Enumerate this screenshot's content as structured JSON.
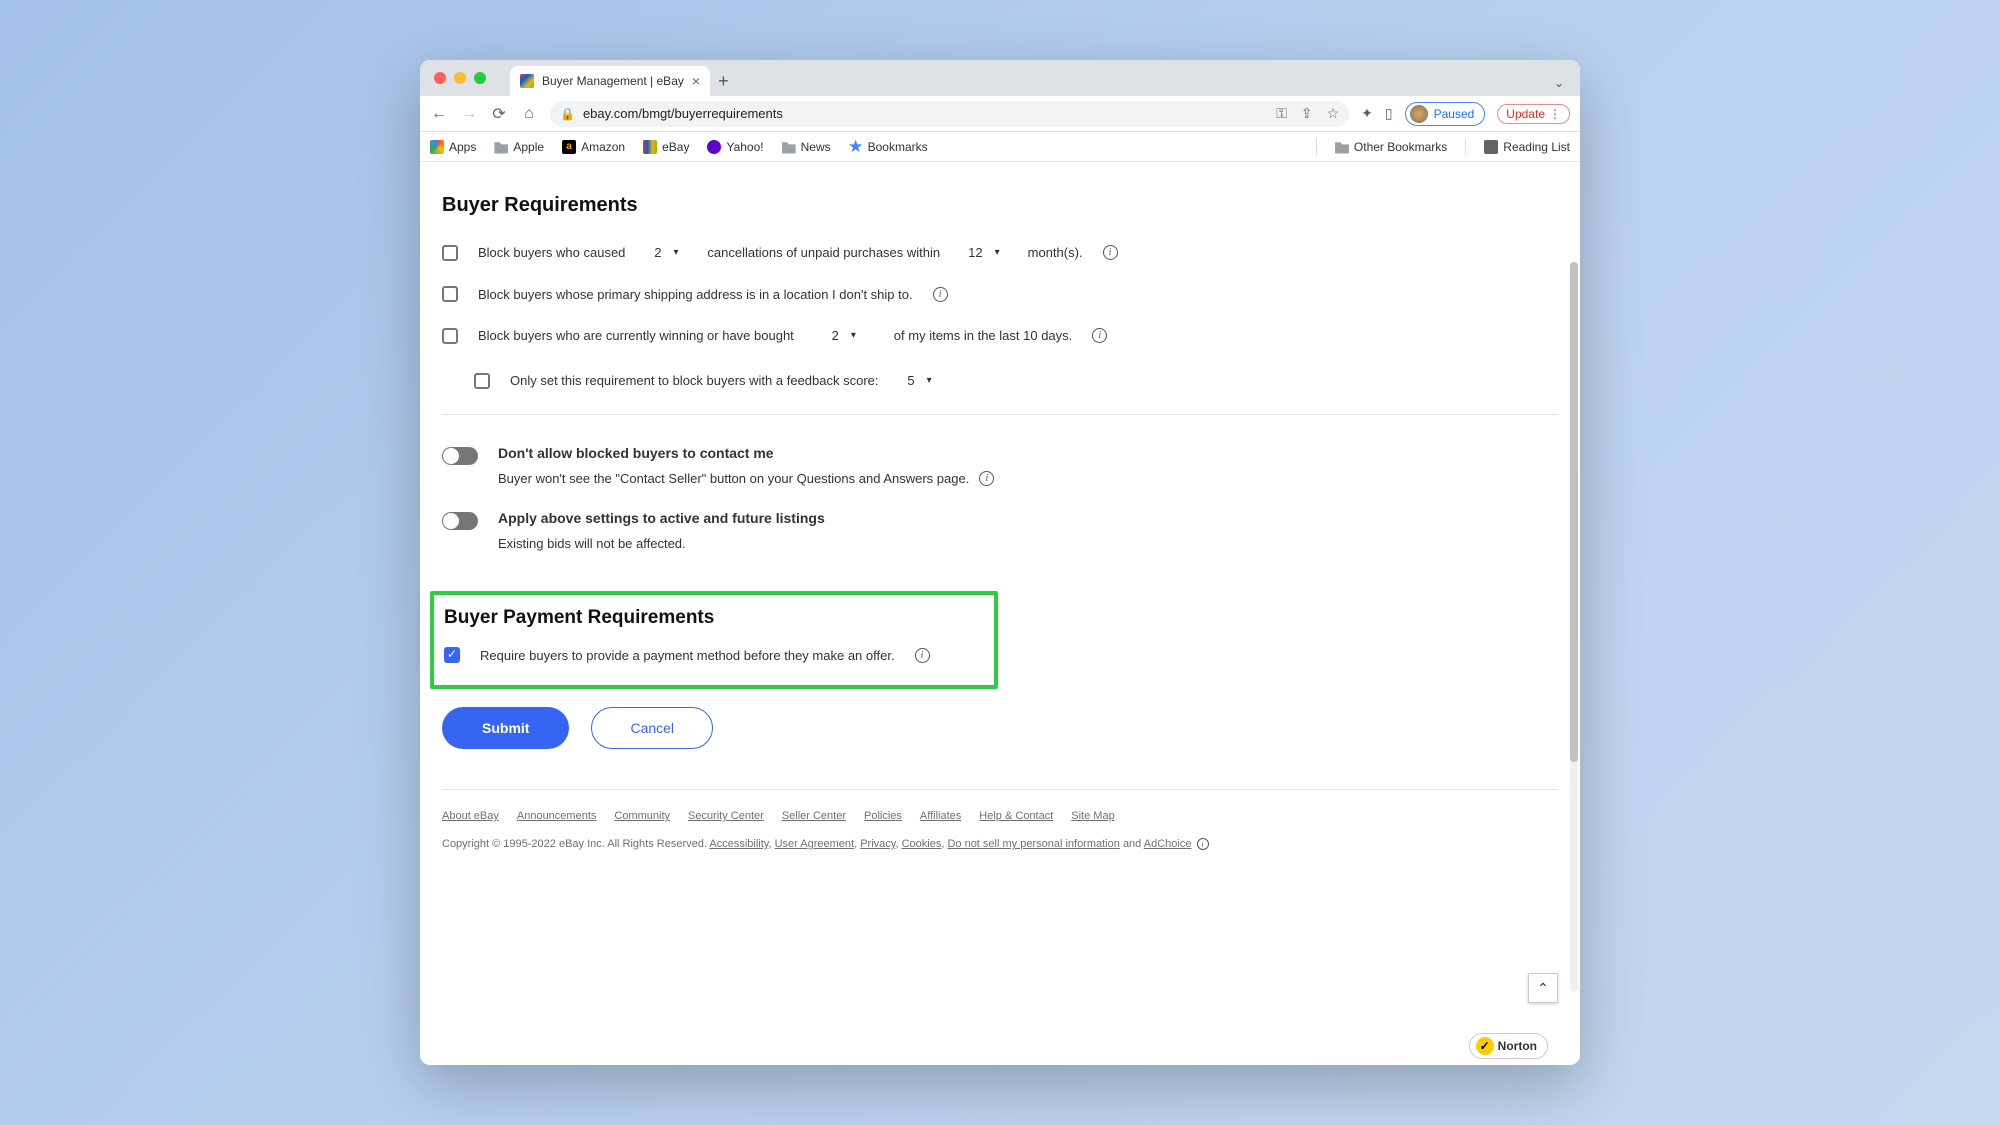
{
  "browser": {
    "tab_title": "Buyer Management | eBay",
    "url": "ebay.com/bmgt/buyerrequirements",
    "profile_status": "Paused",
    "update_label": "Update"
  },
  "bookmarks": {
    "apps": "Apps",
    "items": [
      "Apple",
      "Amazon",
      "eBay",
      "Yahoo!",
      "News",
      "Bookmarks"
    ],
    "other_bookmarks": "Other Bookmarks",
    "reading_list": "Reading List"
  },
  "page": {
    "heading_requirements": "Buyer Requirements",
    "row1_pre": "Block buyers who caused",
    "row1_dd": "2",
    "row1_mid": "cancellations of unpaid purchases within",
    "row1_dd2": "12",
    "row1_post": "month(s).",
    "row2": "Block buyers whose primary shipping address is in a location I don't ship to.",
    "row3_pre": "Block buyers who are currently winning or have bought",
    "row3_dd": "2",
    "row3_post": "of my items in the last 10 days.",
    "row4_label": "Only set this requirement to block buyers with a feedback score:",
    "row4_dd": "5",
    "toggle1_title": "Don't allow blocked buyers to contact me",
    "toggle1_desc": "Buyer won't see the \"Contact Seller\" button on your Questions and Answers page.",
    "toggle2_title": "Apply above settings to active and future listings",
    "toggle2_desc": "Existing bids will not be affected.",
    "heading_payment": "Buyer Payment Requirements",
    "payment_row": "Require buyers to provide a payment method before they make an offer.",
    "submit": "Submit",
    "cancel": "Cancel"
  },
  "footer": {
    "links": [
      "About eBay",
      "Announcements",
      "Community",
      "Security Center",
      "Seller Center",
      "Policies",
      "Affiliates",
      "Help & Contact",
      "Site Map"
    ],
    "copyright_pre": "Copyright © 1995-2022 eBay Inc. All Rights Reserved. ",
    "legal_links": [
      "Accessibility",
      "User Agreement",
      "Privacy",
      "Cookies",
      "Do not sell my personal information"
    ],
    "and": " and ",
    "adchoice": "AdChoice",
    "norton": "Norton"
  }
}
